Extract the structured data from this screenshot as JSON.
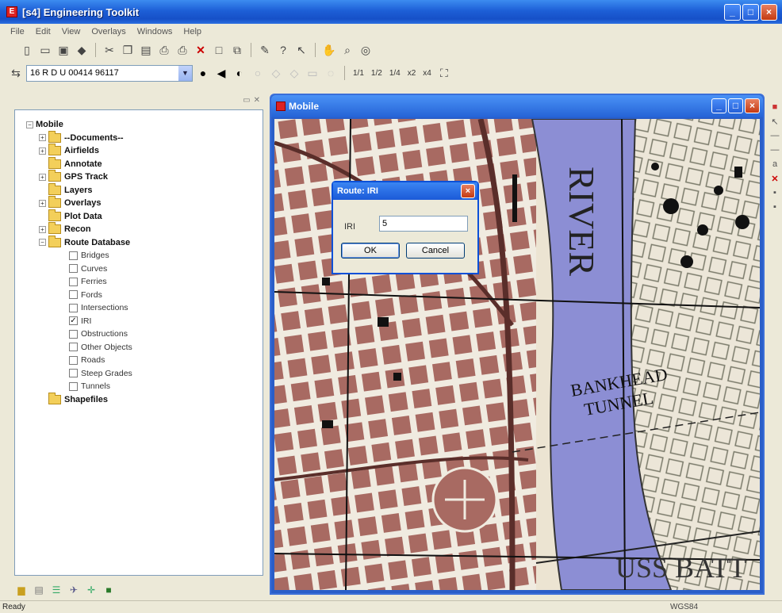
{
  "app": {
    "title": "[s4] Engineering Toolkit"
  },
  "menubar": {
    "items": [
      "File",
      "Edit",
      "View",
      "Overlays",
      "Windows",
      "Help"
    ]
  },
  "toolbar": {
    "grid_reference": "16 R D U 00414 96117",
    "scale_buttons": [
      "1/1",
      "1/2",
      "1/4",
      "x2",
      "x4"
    ]
  },
  "tree": {
    "root": "Mobile",
    "folders_top": [
      "--Documents--",
      "Airfields",
      "Annotate",
      "GPS Track",
      "Layers",
      "Overlays",
      "Plot Data",
      "Recon",
      "Route Database"
    ],
    "route_items": [
      {
        "label": "Bridges",
        "checked": false
      },
      {
        "label": "Curves",
        "checked": false
      },
      {
        "label": "Ferries",
        "checked": false
      },
      {
        "label": "Fords",
        "checked": false
      },
      {
        "label": "Intersections",
        "checked": false
      },
      {
        "label": "IRI",
        "checked": true
      },
      {
        "label": "Obstructions",
        "checked": false
      },
      {
        "label": "Other Objects",
        "checked": false
      },
      {
        "label": "Roads",
        "checked": false
      },
      {
        "label": "Steep Grades",
        "checked": false
      },
      {
        "label": "Tunnels",
        "checked": false
      }
    ],
    "folders_bottom": [
      "Shapefiles"
    ]
  },
  "map_window": {
    "title": "Mobile",
    "labels": {
      "river": "RIVER",
      "tunnel_line1": "BANKHEAD",
      "tunnel_line2": "TUNNEL",
      "ship": "USS BATT"
    }
  },
  "dialog": {
    "title": "Route: IRI",
    "field_label": "IRI",
    "field_value": "5",
    "ok_label": "OK",
    "cancel_label": "Cancel"
  },
  "status": {
    "text": "Ready",
    "coord": "WGS84"
  },
  "colors": {
    "river": "#8c8ed4",
    "block": "#a86a62",
    "street": "#f0ebe0",
    "road_dark": "#5a2e2a"
  }
}
